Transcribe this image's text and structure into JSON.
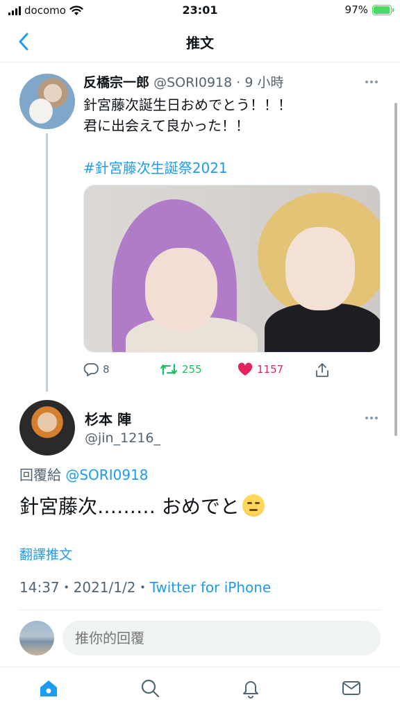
{
  "status_bar": {
    "carrier": "docomo",
    "time": "23:01",
    "battery": "97%",
    "battery_level": 0.97
  },
  "nav": {
    "title": "推文"
  },
  "tweet1": {
    "name": "反橋宗一郎",
    "handle": "@SORI0918",
    "time_sep": " · ",
    "time": "9 小時",
    "line1": "針宮藤次誕生日おめでとう！！！",
    "line2": "君に出会えて良かった！！",
    "hashtag": "#針宮藤次生誕祭2021",
    "replies": "8",
    "retweets": "255",
    "likes": "1157"
  },
  "tweet2": {
    "name": "杉本 陣",
    "handle": "@jin_1216_",
    "reply_prefix": "回覆給",
    "reply_handle": "@SORI0918",
    "text": "針宮藤次……… おめでと",
    "translate": "翻譯推文",
    "timestamp": "14:37・2021/1/2・",
    "source": "Twitter for iPhone"
  },
  "reply_bar": {
    "placeholder": "推你的回覆"
  },
  "colors": {
    "accent": "#1d9bf0",
    "retweet": "#17bf63",
    "like": "#e0245e"
  },
  "icons": [
    "wifi-icon",
    "battery-icon",
    "back-chevron-icon",
    "more-icon",
    "reply-icon",
    "retweet-icon",
    "heart-icon",
    "share-icon",
    "home-icon",
    "search-icon",
    "bell-icon",
    "mail-icon"
  ]
}
